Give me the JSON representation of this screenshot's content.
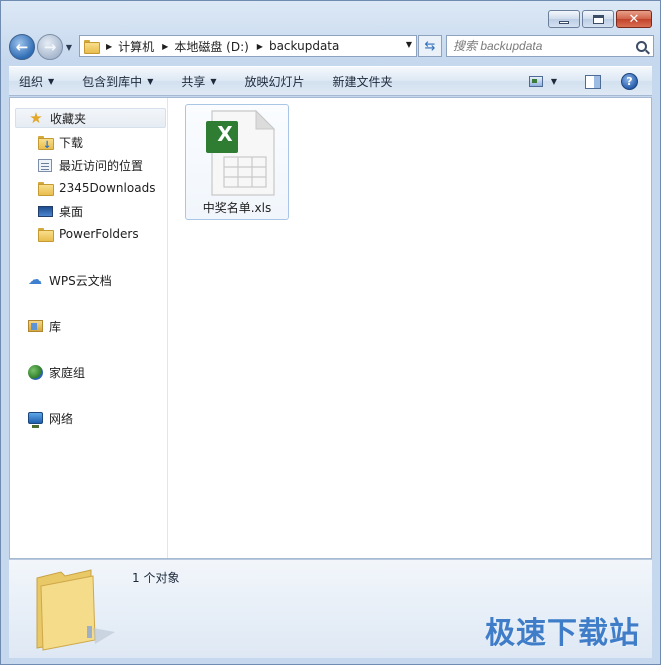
{
  "window": {
    "caption_buttons": {
      "minimize": "–",
      "maximize": "□",
      "close": "✕"
    }
  },
  "address_bar": {
    "crumbs": [
      "计算机",
      "本地磁盘 (D:)",
      "backupdata"
    ]
  },
  "search": {
    "placeholder": "搜索 backupdata"
  },
  "toolbar": {
    "organize": "组织",
    "include_in_library": "包含到库中",
    "share": "共享",
    "slideshow": "放映幻灯片",
    "new_folder": "新建文件夹",
    "help": "?"
  },
  "sidebar": {
    "favorites": "收藏夹",
    "items": [
      {
        "label": "下载",
        "icon": "download-folder-icon"
      },
      {
        "label": "最近访问的位置",
        "icon": "recent-places-icon"
      },
      {
        "label": "2345Downloads",
        "icon": "folder-icon"
      },
      {
        "label": "桌面",
        "icon": "desktop-icon"
      },
      {
        "label": "PowerFolders",
        "icon": "folder-icon"
      }
    ],
    "wps_cloud": "WPS云文档",
    "libraries": "库",
    "homegroup": "家庭组",
    "network": "网络"
  },
  "files": [
    {
      "name": "中奖名单.xls",
      "icon": "excel-file-icon",
      "badge": "X"
    }
  ],
  "details": {
    "count_text": "1 个对象"
  },
  "watermark": "极速下载站",
  "colors": {
    "excel_green": "#2e7d32",
    "accent_blue": "#3f7dc9"
  }
}
